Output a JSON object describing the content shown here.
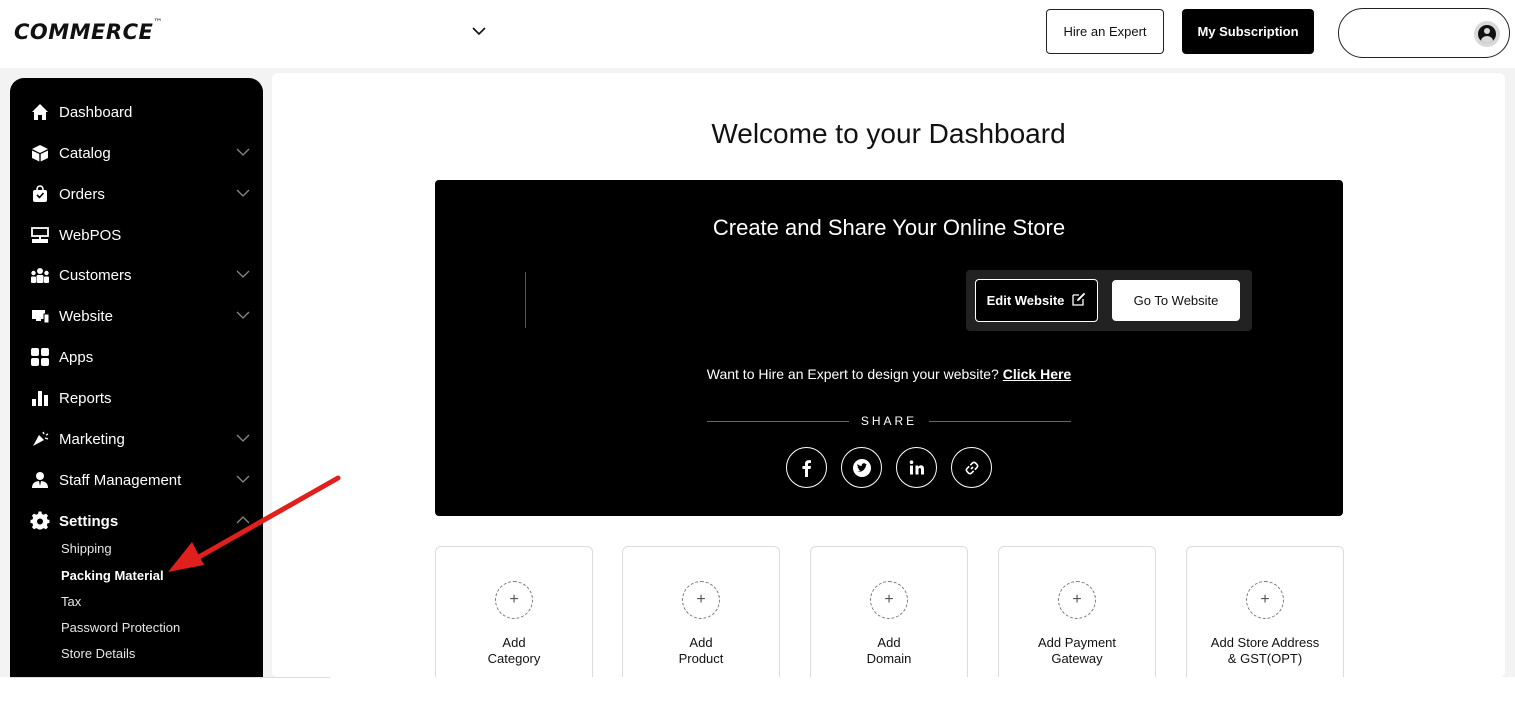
{
  "header": {
    "logo": "COMMERCE",
    "logo_tm": "™",
    "hire_expert_label": "Hire an Expert",
    "subscription_label": "My Subscription"
  },
  "sidebar": {
    "items": [
      {
        "label": "Dashboard",
        "icon": "home-icon",
        "expandable": false
      },
      {
        "label": "Catalog",
        "icon": "box-icon",
        "expandable": true
      },
      {
        "label": "Orders",
        "icon": "shopping-bag-icon",
        "expandable": true
      },
      {
        "label": "WebPOS",
        "icon": "pos-terminal-icon",
        "expandable": false
      },
      {
        "label": "Customers",
        "icon": "users-icon",
        "expandable": true
      },
      {
        "label": "Website",
        "icon": "monitor-icon",
        "expandable": true
      },
      {
        "label": "Apps",
        "icon": "grid-icon",
        "expandable": false
      },
      {
        "label": "Reports",
        "icon": "bar-chart-icon",
        "expandable": false
      },
      {
        "label": "Marketing",
        "icon": "megaphone-icon",
        "expandable": true
      },
      {
        "label": "Staff Management",
        "icon": "staff-icon",
        "expandable": true
      },
      {
        "label": "Settings",
        "icon": "gear-icon",
        "expandable": true,
        "expanded": true
      }
    ],
    "settings_subitems": [
      {
        "label": "Shipping",
        "active": false
      },
      {
        "label": "Packing Material",
        "active": true
      },
      {
        "label": "Tax",
        "active": false
      },
      {
        "label": "Password Protection",
        "active": false
      },
      {
        "label": "Store Details",
        "active": false
      }
    ]
  },
  "main": {
    "welcome_title": "Welcome to your Dashboard",
    "hero": {
      "title": "Create and Share Your Online Store",
      "edit_website_label": "Edit Website",
      "go_to_website_label": "Go To Website",
      "hire_text": "Want to Hire an Expert to design your website?",
      "click_here_label": "Click Here",
      "share_label": "SHARE",
      "social_icons": [
        "facebook-icon",
        "twitter-icon",
        "linkedin-icon",
        "link-icon"
      ]
    },
    "cards": [
      {
        "line1": "Add",
        "line2": "Category"
      },
      {
        "line1": "Add",
        "line2": "Product"
      },
      {
        "line1": "Add",
        "line2": "Domain"
      },
      {
        "line1": "Add Payment",
        "line2": "Gateway"
      },
      {
        "line1": "Add Store Address",
        "line2": "& GST(OPT)"
      }
    ],
    "plus_symbol": "+"
  },
  "colors": {
    "sidebar_bg": "#000000",
    "hero_bg": "#000000",
    "annotation_arrow": "#e0201c",
    "page_bg": "#f3f3f3"
  }
}
